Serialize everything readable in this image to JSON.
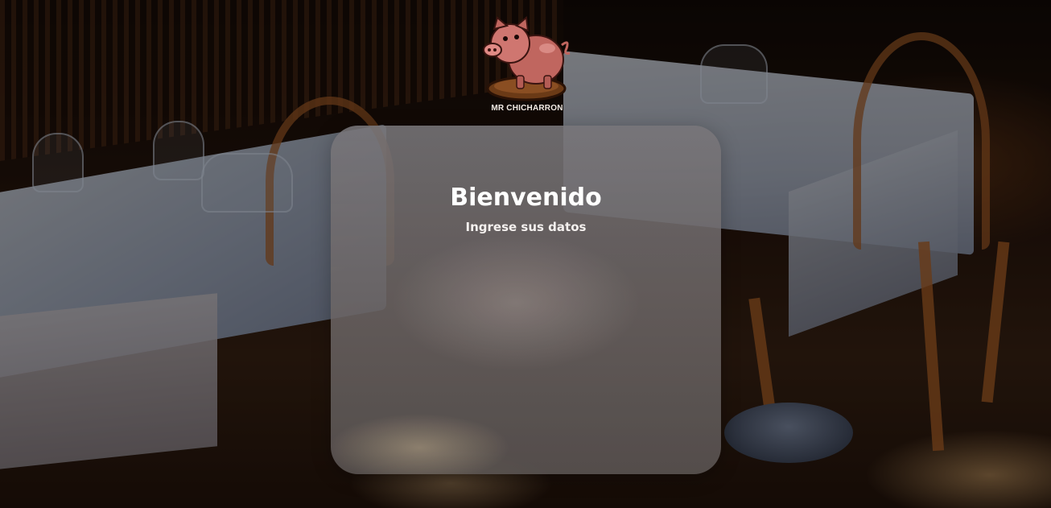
{
  "logo": {
    "icon": "pig-icon",
    "text": "MR CHICHARRON"
  },
  "card": {
    "title": "Bienvenido",
    "subtitle": "Ingrese sus datos"
  },
  "colors": {
    "card_background": "#6e6a6c",
    "text": "#ffffff",
    "pig": "#c8706a",
    "logo_base": "#6b3a16"
  }
}
